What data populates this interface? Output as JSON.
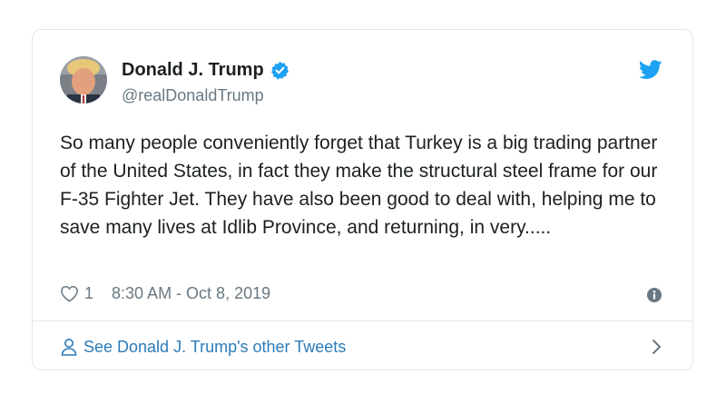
{
  "tweet": {
    "author_name": "Donald J. Trump",
    "handle": "@realDonaldTrump",
    "verified": true,
    "text": "So many people conveniently forget that Turkey is a big trading partner of the United States, in fact they make the structural steel frame for our F-35 Fighter Jet. They have also been good to deal with, helping me to save many lives at Idlib Province, and returning, in very.....",
    "like_count": "1",
    "timestamp": "8:30 AM - Oct 8, 2019"
  },
  "footer": {
    "label": "See Donald J. Trump's other Tweets"
  },
  "icons": {
    "verified": "verified-badge-icon",
    "brand": "twitter-bird-icon",
    "like": "heart-icon",
    "info": "info-icon",
    "profile": "person-icon",
    "navigate": "chevron-right-icon"
  },
  "colors": {
    "brand_blue": "#1da1f2",
    "link_blue": "#2b7bb9",
    "text": "#1c2022",
    "muted": "#697882",
    "border": "#e1e8ed"
  }
}
